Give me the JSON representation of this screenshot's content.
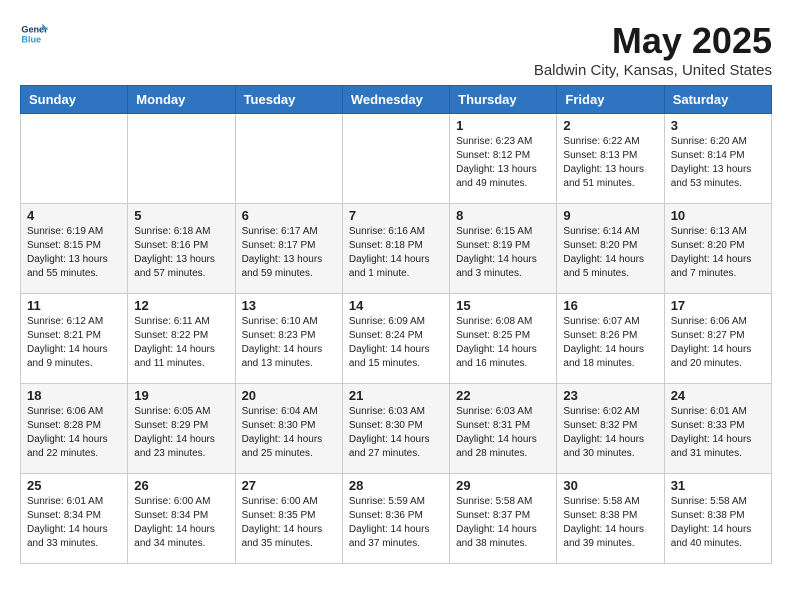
{
  "header": {
    "logo_line1": "General",
    "logo_line2": "Blue",
    "month": "May 2025",
    "location": "Baldwin City, Kansas, United States"
  },
  "weekdays": [
    "Sunday",
    "Monday",
    "Tuesday",
    "Wednesday",
    "Thursday",
    "Friday",
    "Saturday"
  ],
  "weeks": [
    [
      {
        "day": "",
        "info": ""
      },
      {
        "day": "",
        "info": ""
      },
      {
        "day": "",
        "info": ""
      },
      {
        "day": "",
        "info": ""
      },
      {
        "day": "1",
        "info": "Sunrise: 6:23 AM\nSunset: 8:12 PM\nDaylight: 13 hours\nand 49 minutes."
      },
      {
        "day": "2",
        "info": "Sunrise: 6:22 AM\nSunset: 8:13 PM\nDaylight: 13 hours\nand 51 minutes."
      },
      {
        "day": "3",
        "info": "Sunrise: 6:20 AM\nSunset: 8:14 PM\nDaylight: 13 hours\nand 53 minutes."
      }
    ],
    [
      {
        "day": "4",
        "info": "Sunrise: 6:19 AM\nSunset: 8:15 PM\nDaylight: 13 hours\nand 55 minutes."
      },
      {
        "day": "5",
        "info": "Sunrise: 6:18 AM\nSunset: 8:16 PM\nDaylight: 13 hours\nand 57 minutes."
      },
      {
        "day": "6",
        "info": "Sunrise: 6:17 AM\nSunset: 8:17 PM\nDaylight: 13 hours\nand 59 minutes."
      },
      {
        "day": "7",
        "info": "Sunrise: 6:16 AM\nSunset: 8:18 PM\nDaylight: 14 hours\nand 1 minute."
      },
      {
        "day": "8",
        "info": "Sunrise: 6:15 AM\nSunset: 8:19 PM\nDaylight: 14 hours\nand 3 minutes."
      },
      {
        "day": "9",
        "info": "Sunrise: 6:14 AM\nSunset: 8:20 PM\nDaylight: 14 hours\nand 5 minutes."
      },
      {
        "day": "10",
        "info": "Sunrise: 6:13 AM\nSunset: 8:20 PM\nDaylight: 14 hours\nand 7 minutes."
      }
    ],
    [
      {
        "day": "11",
        "info": "Sunrise: 6:12 AM\nSunset: 8:21 PM\nDaylight: 14 hours\nand 9 minutes."
      },
      {
        "day": "12",
        "info": "Sunrise: 6:11 AM\nSunset: 8:22 PM\nDaylight: 14 hours\nand 11 minutes."
      },
      {
        "day": "13",
        "info": "Sunrise: 6:10 AM\nSunset: 8:23 PM\nDaylight: 14 hours\nand 13 minutes."
      },
      {
        "day": "14",
        "info": "Sunrise: 6:09 AM\nSunset: 8:24 PM\nDaylight: 14 hours\nand 15 minutes."
      },
      {
        "day": "15",
        "info": "Sunrise: 6:08 AM\nSunset: 8:25 PM\nDaylight: 14 hours\nand 16 minutes."
      },
      {
        "day": "16",
        "info": "Sunrise: 6:07 AM\nSunset: 8:26 PM\nDaylight: 14 hours\nand 18 minutes."
      },
      {
        "day": "17",
        "info": "Sunrise: 6:06 AM\nSunset: 8:27 PM\nDaylight: 14 hours\nand 20 minutes."
      }
    ],
    [
      {
        "day": "18",
        "info": "Sunrise: 6:06 AM\nSunset: 8:28 PM\nDaylight: 14 hours\nand 22 minutes."
      },
      {
        "day": "19",
        "info": "Sunrise: 6:05 AM\nSunset: 8:29 PM\nDaylight: 14 hours\nand 23 minutes."
      },
      {
        "day": "20",
        "info": "Sunrise: 6:04 AM\nSunset: 8:30 PM\nDaylight: 14 hours\nand 25 minutes."
      },
      {
        "day": "21",
        "info": "Sunrise: 6:03 AM\nSunset: 8:30 PM\nDaylight: 14 hours\nand 27 minutes."
      },
      {
        "day": "22",
        "info": "Sunrise: 6:03 AM\nSunset: 8:31 PM\nDaylight: 14 hours\nand 28 minutes."
      },
      {
        "day": "23",
        "info": "Sunrise: 6:02 AM\nSunset: 8:32 PM\nDaylight: 14 hours\nand 30 minutes."
      },
      {
        "day": "24",
        "info": "Sunrise: 6:01 AM\nSunset: 8:33 PM\nDaylight: 14 hours\nand 31 minutes."
      }
    ],
    [
      {
        "day": "25",
        "info": "Sunrise: 6:01 AM\nSunset: 8:34 PM\nDaylight: 14 hours\nand 33 minutes."
      },
      {
        "day": "26",
        "info": "Sunrise: 6:00 AM\nSunset: 8:34 PM\nDaylight: 14 hours\nand 34 minutes."
      },
      {
        "day": "27",
        "info": "Sunrise: 6:00 AM\nSunset: 8:35 PM\nDaylight: 14 hours\nand 35 minutes."
      },
      {
        "day": "28",
        "info": "Sunrise: 5:59 AM\nSunset: 8:36 PM\nDaylight: 14 hours\nand 37 minutes."
      },
      {
        "day": "29",
        "info": "Sunrise: 5:58 AM\nSunset: 8:37 PM\nDaylight: 14 hours\nand 38 minutes."
      },
      {
        "day": "30",
        "info": "Sunrise: 5:58 AM\nSunset: 8:38 PM\nDaylight: 14 hours\nand 39 minutes."
      },
      {
        "day": "31",
        "info": "Sunrise: 5:58 AM\nSunset: 8:38 PM\nDaylight: 14 hours\nand 40 minutes."
      }
    ]
  ]
}
